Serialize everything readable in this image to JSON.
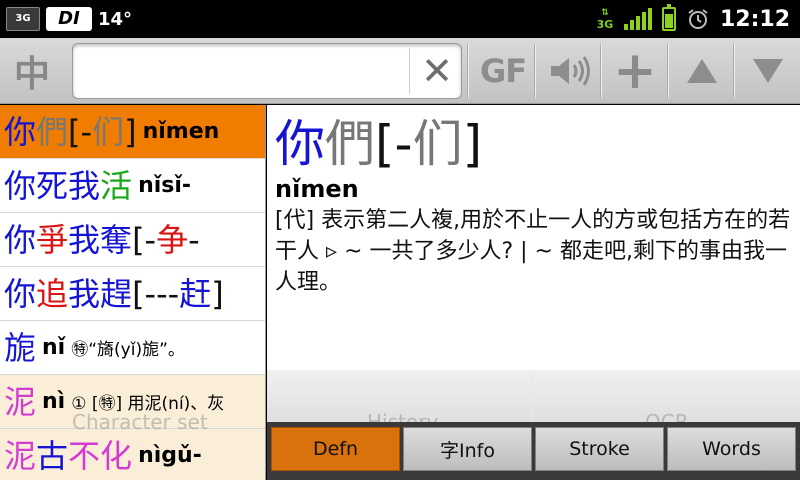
{
  "status_bar": {
    "notification_3g": "3G",
    "app_icon": "DI",
    "temperature": "14°",
    "network_type": "3G",
    "time": "12:12",
    "battery_level": 0.8
  },
  "toolbar": {
    "language_button": "中",
    "search_value": "",
    "search_placeholder": "",
    "clear_icon": "✕",
    "gf_button": "GF",
    "add_button": "+",
    "icons": [
      "language-icon",
      "clear-icon",
      "gf-icon",
      "speaker-icon",
      "add-icon",
      "up-icon",
      "down-icon"
    ]
  },
  "list": {
    "items": [
      {
        "segments": [
          {
            "t": "你",
            "c": "blue"
          },
          {
            "t": "們",
            "c": "gray"
          },
          {
            "t": "[-",
            "c": "black"
          },
          {
            "t": "们",
            "c": "gray"
          },
          {
            "t": "]",
            "c": "black"
          }
        ],
        "pinyin": "nǐmen",
        "gloss": "",
        "selected": true
      },
      {
        "segments": [
          {
            "t": "你",
            "c": "blue"
          },
          {
            "t": "死",
            "c": "blue"
          },
          {
            "t": "我",
            "c": "blue"
          },
          {
            "t": "活",
            "c": "green"
          }
        ],
        "pinyin": "nǐsǐ-",
        "gloss": ""
      },
      {
        "segments": [
          {
            "t": "你",
            "c": "blue"
          },
          {
            "t": "爭",
            "c": "red"
          },
          {
            "t": "我",
            "c": "blue"
          },
          {
            "t": "奪",
            "c": "blue"
          },
          {
            "t": "[-",
            "c": "black"
          },
          {
            "t": "争",
            "c": "red"
          },
          {
            "t": "-",
            "c": "black"
          }
        ],
        "pinyin": "",
        "gloss": ""
      },
      {
        "segments": [
          {
            "t": "你",
            "c": "blue"
          },
          {
            "t": "追",
            "c": "red"
          },
          {
            "t": "我",
            "c": "blue"
          },
          {
            "t": "趕",
            "c": "blue"
          },
          {
            "t": "[---",
            "c": "black"
          },
          {
            "t": "赶",
            "c": "blue"
          },
          {
            "t": "]",
            "c": "black"
          }
        ],
        "pinyin": "",
        "gloss": ""
      },
      {
        "segments": [
          {
            "t": "旎",
            "c": "blue"
          }
        ],
        "pinyin": "nǐ",
        "gloss": "㊕“旖(yǐ)旎”。"
      },
      {
        "segments": [
          {
            "t": "泥",
            "c": "pink"
          }
        ],
        "pinyin": "nì",
        "gloss": "① [㊕] 用泥(ní)、灰",
        "faded": true
      },
      {
        "segments": [
          {
            "t": "泥",
            "c": "pink"
          },
          {
            "t": "古",
            "c": "blue"
          },
          {
            "t": "不",
            "c": "pink"
          },
          {
            "t": "化",
            "c": "pink"
          }
        ],
        "pinyin": "nìgǔ-",
        "gloss": "",
        "faded": true
      }
    ]
  },
  "detail": {
    "headword_segments": [
      {
        "t": "你",
        "c": "blue"
      },
      {
        "t": "們",
        "c": "gray"
      },
      {
        "t": "[-",
        "c": "black"
      },
      {
        "t": "们",
        "c": "gray"
      },
      {
        "t": "]",
        "c": "black"
      }
    ],
    "pinyin": "nǐmen",
    "definition": "[代] 表示第二人複,用於不止一人的方或包括方在的若干人 ▹ ~ 一共了多少人? | ~ 都走吧,剩下的事由我一人理。"
  },
  "ghost_labels": {
    "character_set": "Character set",
    "history": "History",
    "ocr": "OCR"
  },
  "tabs": [
    {
      "label": "Defn",
      "active": true
    },
    {
      "label": "字Info",
      "active": false
    },
    {
      "label": "Stroke",
      "active": false
    },
    {
      "label": "Words",
      "active": false
    }
  ],
  "colors": {
    "blue": "#1414d2",
    "green": "#19a819",
    "red": "#d81414",
    "gray": "#777777",
    "black": "#111111",
    "pink": "#d23cd2",
    "accent_orange": "#f07c00"
  }
}
